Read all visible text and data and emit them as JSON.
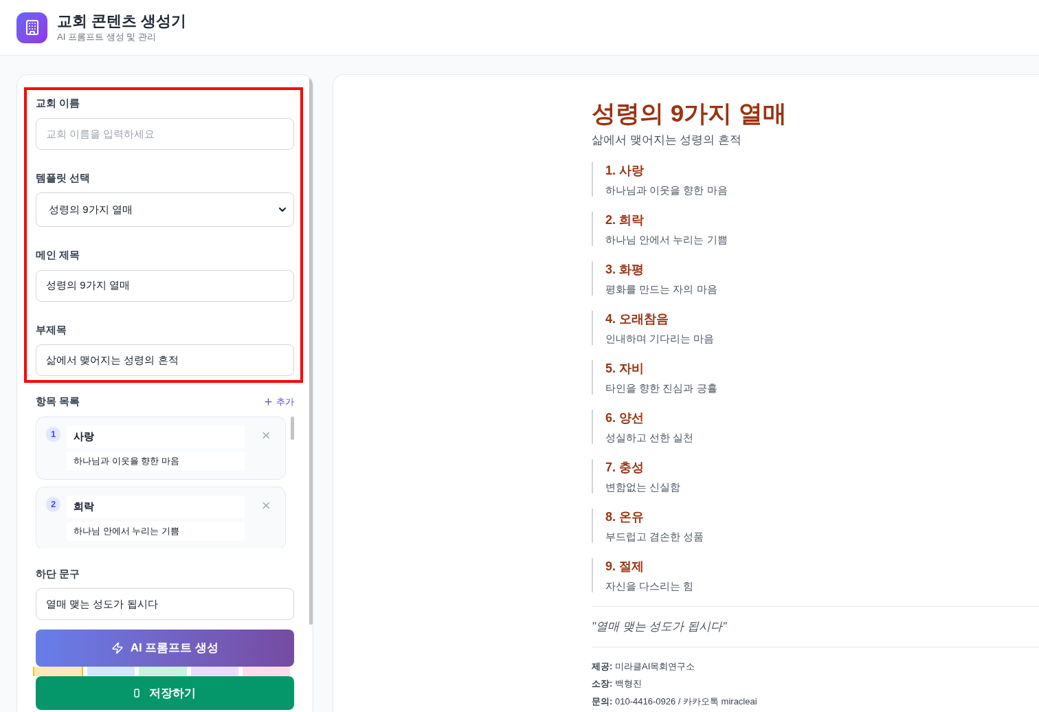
{
  "header": {
    "title": "교회 콘텐츠 생성기",
    "subtitle": "AI 프롬프트 생성 및 관리"
  },
  "form": {
    "highlighted": true,
    "church_name": {
      "label": "교회 이름",
      "placeholder": "교회 이름을 입력하세요"
    },
    "template": {
      "label": "템플릿 선택",
      "value": "성령의 9가지 열매"
    },
    "main_title": {
      "label": "메인 제목",
      "value": "성령의 9가지 열매"
    },
    "subtitle": {
      "label": "부제목",
      "value": "삶에서 맺어지는 성령의 흔적"
    }
  },
  "item_list": {
    "label": "항목 목록",
    "add_button": "추가",
    "items": [
      {
        "number": "1",
        "title": "사랑",
        "description": "하나님과 이웃을 향한 마음"
      },
      {
        "number": "2",
        "title": "희락",
        "description": "하나님 안에서 누리는 기쁨"
      }
    ]
  },
  "footer_text": {
    "label": "하단 문구",
    "value": "열매 맺는 성도가 됩시다"
  },
  "color_swatches": [
    {
      "color": "#fde9b8",
      "selected": true
    },
    {
      "color": "#d6e6fd",
      "selected": false
    },
    {
      "color": "#c9f2e0",
      "selected": false
    },
    {
      "color": "#ebdcfd",
      "selected": false
    },
    {
      "color": "#fddcea",
      "selected": false
    }
  ],
  "generate_button": "AI 프롬프트 생성",
  "save_button": "저장하기",
  "preview": {
    "title": "성령의 9가지 열매",
    "subtitle": "삶에서 맺어지는 성령의 흔적",
    "items": [
      {
        "title": "1. 사랑",
        "description": "하나님과 이웃을 향한 마음"
      },
      {
        "title": "2. 희락",
        "description": "하나님 안에서 누리는 기쁨"
      },
      {
        "title": "3. 화평",
        "description": "평화를 만드는 자의 마음"
      },
      {
        "title": "4. 오래참음",
        "description": "인내하며 기다리는 마음"
      },
      {
        "title": "5. 자비",
        "description": "타인을 향한 진심과 긍휼"
      },
      {
        "title": "6. 양선",
        "description": "성실하고 선한 실천"
      },
      {
        "title": "7. 충성",
        "description": "변함없는 신실함"
      },
      {
        "title": "8. 온유",
        "description": "부드럽고 겸손한 성품"
      },
      {
        "title": "9. 절제",
        "description": "자신을 다스리는 힘"
      }
    ],
    "quote": "\"열매 맺는 성도가 됩시다\"",
    "credits": [
      "**제공:** 미라클AI목회연구소",
      "**소장:** 백형진",
      "**문의:** 010-4416-0926 / 카카오톡 miracleai"
    ]
  }
}
